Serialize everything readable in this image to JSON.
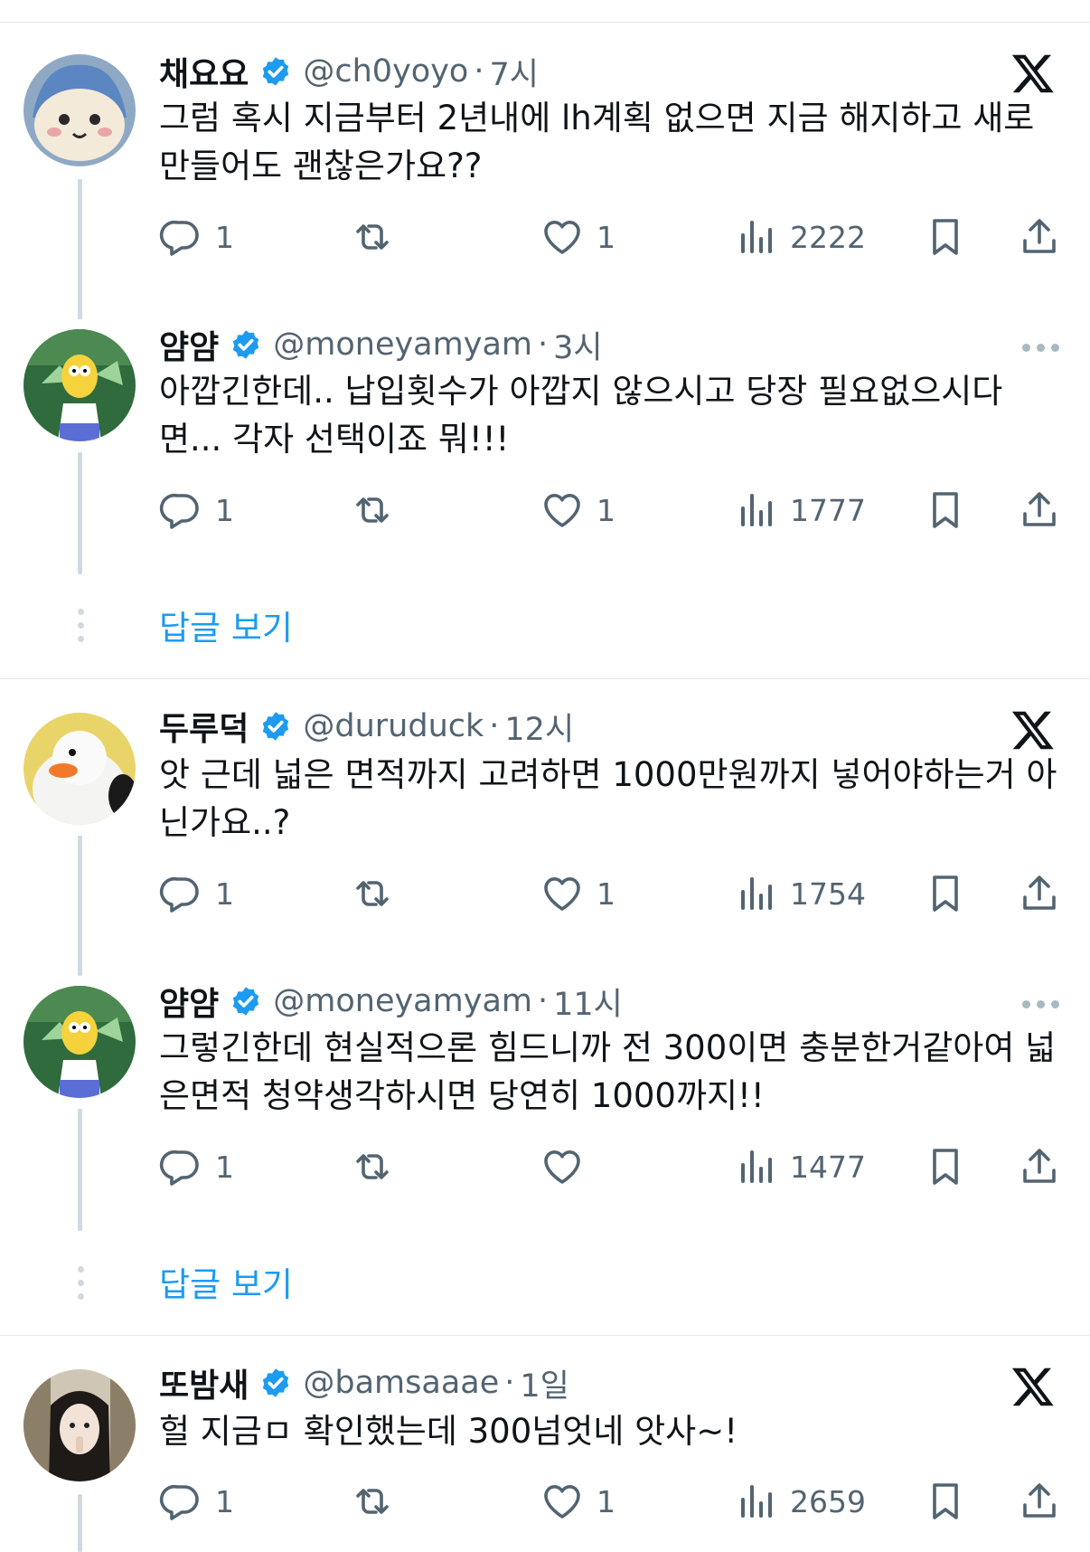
{
  "tweets": [
    {
      "name": "채요요",
      "handle": "@ch0yoyo",
      "time": "7시",
      "text": "그럼 혹시 지금부터 2년내에 lh계획 없으면 지금 해지하고 새로 만들어도 괜찮은가요??",
      "replies": "1",
      "retweets": "",
      "likes": "1",
      "views": "2222",
      "corner_icon": "x-logo-icon"
    },
    {
      "name": "얌얌",
      "handle": "@moneyamyam",
      "time": "3시",
      "text": "아깝긴한데.. 납입횟수가 아깝지 않으시고 당장 필요없으시다면... 각자 선택이죠 뭐!!!",
      "replies": "1",
      "retweets": "",
      "likes": "1",
      "views": "1777",
      "corner_icon": "more-icon"
    },
    {
      "name": "두루덕",
      "handle": "@duruduck",
      "time": "12시",
      "text": "앗 근데 넓은 면적까지 고려하면 1000만원까지 넣어야하는거 아닌가요..?",
      "replies": "1",
      "retweets": "",
      "likes": "1",
      "views": "1754",
      "corner_icon": "x-logo-icon"
    },
    {
      "name": "얌얌",
      "handle": "@moneyamyam",
      "time": "11시",
      "text": "그렇긴한데 현실적으론 힘드니까 전 300이면 충분한거같아여 넓은면적 청약생각하시면 당연히 1000까지!!",
      "replies": "1",
      "retweets": "",
      "likes": "",
      "views": "1477",
      "corner_icon": "more-icon"
    },
    {
      "name": "또밤새",
      "handle": "@bamsaaae",
      "time": "1일",
      "text": "헐 지금ㅁ 확인했는데 300넘엇네 앗사~!",
      "replies": "1",
      "retweets": "",
      "likes": "1",
      "views": "2659",
      "corner_icon": "x-logo-icon"
    }
  ],
  "show_replies_label": "답글 보기",
  "separator": "·",
  "colors": {
    "accent": "#1d9bf0",
    "text": "#0f1419",
    "muted": "#536471",
    "border": "#e5e7ea",
    "thread": "#cfd9de"
  }
}
